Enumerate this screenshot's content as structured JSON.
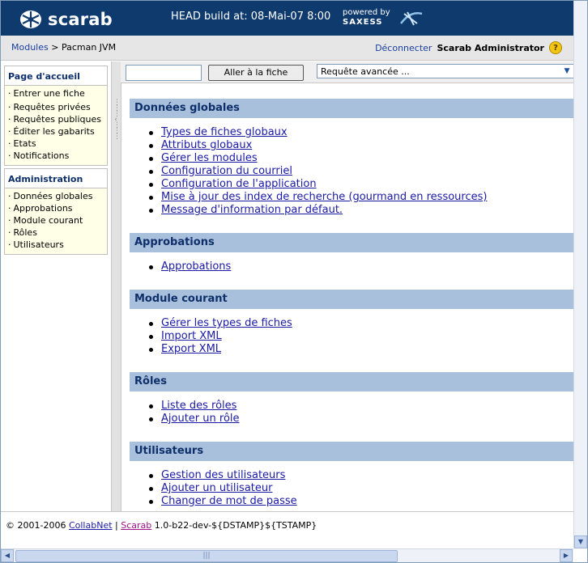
{
  "header": {
    "logo_text": "scarab",
    "build_text": "HEAD build at: 08-Mai-07 8:00",
    "powered_by": "powered by",
    "powered_brand": "SAXESS"
  },
  "subbar": {
    "breadcrumb_link": "Modules",
    "breadcrumb_sep": ">",
    "breadcrumb_current": "Pacman JVM",
    "logout": "Déconnecter",
    "user": "Scarab Administrator",
    "help": "?"
  },
  "sidebar": {
    "home": {
      "title": "Page d'accueil",
      "items": [
        "Entrer une fiche",
        "Requêtes privées",
        "Requêtes publiques",
        "Éditer les gabarits",
        "Etats",
        "Notifications"
      ]
    },
    "admin": {
      "title": "Administration",
      "items": [
        "Données globales",
        "Approbations",
        "Module courant",
        "Rôles",
        "Utilisateurs"
      ]
    }
  },
  "toolbar": {
    "quick_value": "",
    "goto_label": "Aller à la fiche",
    "query_selected": "Requête avancée ..."
  },
  "sections": [
    {
      "title": "Données globales",
      "links": [
        "Types de fiches globaux",
        "Attributs globaux",
        "Gérer les modules",
        "Configuration du courriel",
        "Configuration de l'application",
        "Mise à jour des index de recherche (gourmand en ressources)",
        "Message d'information par défaut."
      ]
    },
    {
      "title": "Approbations",
      "links": [
        "Approbations"
      ]
    },
    {
      "title": "Module courant",
      "links": [
        "Gérer les types de fiches",
        "Import XML",
        "Export XML"
      ]
    },
    {
      "title": "Rôles",
      "links": [
        "Liste des rôles",
        "Ajouter un rôle"
      ]
    },
    {
      "title": "Utilisateurs",
      "links": [
        "Gestion des utilisateurs",
        "Ajouter un utilisateur",
        "Changer de mot de passe"
      ]
    }
  ],
  "footer": {
    "copyright": "© 2001-2006",
    "collabnet": "CollabNet",
    "sep": "|",
    "scarab": "Scarab",
    "version": "1.0-b22-dev-${DSTAMP}${TSTAMP}"
  },
  "colors": {
    "topbar": "#0e3a6e",
    "section_header": "#a8c0dc",
    "nav_bg": "#ffffe8",
    "link": "#1a1aa6"
  }
}
